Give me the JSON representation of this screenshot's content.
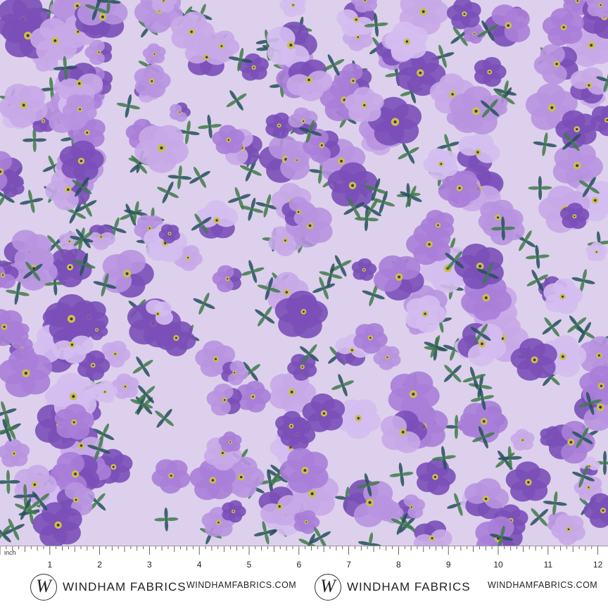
{
  "fabric": {
    "description_colors": {
      "background": "#ddd0ec",
      "petal_light": "#c8a8e8",
      "petal_mid": "#a97ed8",
      "petal_dark": "#7a4fb8",
      "center": "#c6c24a",
      "leaf": "#3f7a4a",
      "leaf_dark": "#24505a"
    }
  },
  "ruler": {
    "unit": "inch",
    "numbers": [
      "1",
      "2",
      "3",
      "4",
      "5",
      "6",
      "7",
      "8",
      "9",
      "10",
      "11",
      "12"
    ]
  },
  "branding": {
    "logo_letter": "W",
    "name": "WINDHAM FABRICS",
    "url": "WINDHAMFABRICS.COM"
  }
}
